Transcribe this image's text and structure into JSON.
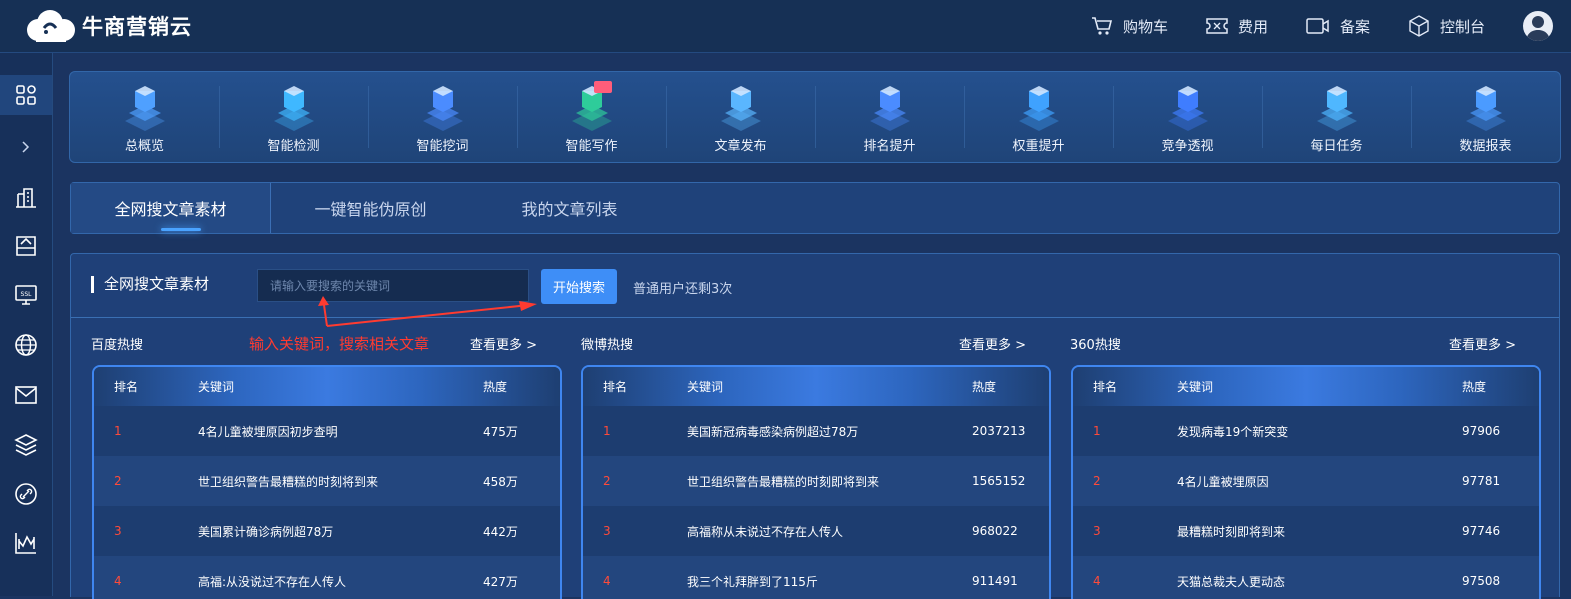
{
  "brand": {
    "name": "牛商营销云"
  },
  "topnav": [
    {
      "label": "购物车",
      "icon": "cart-icon"
    },
    {
      "label": "费用",
      "icon": "ticket-icon"
    },
    {
      "label": "备案",
      "icon": "camera-icon"
    },
    {
      "label": "控制台",
      "icon": "cube-icon"
    }
  ],
  "sidebar": [
    "grid-icon",
    "chevron-right-icon",
    "building-icon",
    "drive-icon",
    "ssl-icon",
    "globe-icon",
    "mail-icon",
    "layers-icon",
    "link-icon",
    "chart-icon"
  ],
  "modules": [
    {
      "label": "总概览",
      "color": "#4fa0ff"
    },
    {
      "label": "智能检测",
      "color": "#3fb8ff"
    },
    {
      "label": "智能挖词",
      "color": "#4b8cff"
    },
    {
      "label": "智能写作",
      "color": "#2ecc9a"
    },
    {
      "label": "文章发布",
      "color": "#5ab6ff"
    },
    {
      "label": "排名提升",
      "color": "#4b8cff"
    },
    {
      "label": "权重提升",
      "color": "#3fa2ff"
    },
    {
      "label": "竞争透视",
      "color": "#3f7dff"
    },
    {
      "label": "每日任务",
      "color": "#4fb7ff"
    },
    {
      "label": "数据报表",
      "color": "#4b9bff"
    }
  ],
  "tabs": [
    {
      "label": "全网搜文章素材",
      "active": true
    },
    {
      "label": "一键智能伪原创",
      "active": false
    },
    {
      "label": "我的文章列表",
      "active": false
    }
  ],
  "search": {
    "title": "全网搜文章素材",
    "placeholder": "请输入要搜索的关键词",
    "button": "开始搜索",
    "quota": "普通用户还剩3次",
    "annotation": "输入关键词，搜索相关文章"
  },
  "hot_lists": [
    {
      "title": "百度热搜",
      "more": "查看更多 >",
      "headers": {
        "rank": "排名",
        "keyword": "关键词",
        "heat": "热度"
      },
      "rows": [
        {
          "rank": "1",
          "keyword": "4名儿童被埋原因初步查明",
          "heat": "475万"
        },
        {
          "rank": "2",
          "keyword": "世卫组织警告最糟糕的时刻将到来",
          "heat": "458万"
        },
        {
          "rank": "3",
          "keyword": "美国累计确诊病例超78万",
          "heat": "442万"
        },
        {
          "rank": "4",
          "keyword": "高福:从没说过不存在人传人",
          "heat": "427万"
        }
      ]
    },
    {
      "title": "微博热搜",
      "more": "查看更多 >",
      "headers": {
        "rank": "排名",
        "keyword": "关键词",
        "heat": "热度"
      },
      "rows": [
        {
          "rank": "1",
          "keyword": "美国新冠病毒感染病例超过78万",
          "heat": "2037213"
        },
        {
          "rank": "2",
          "keyword": "世卫组织警告最糟糕的时刻即将到来",
          "heat": "1565152"
        },
        {
          "rank": "3",
          "keyword": "高福称从未说过不存在人传人",
          "heat": "968022"
        },
        {
          "rank": "4",
          "keyword": "我三个礼拜胖到了115斤",
          "heat": "911491"
        }
      ]
    },
    {
      "title": "360热搜",
      "more": "查看更多 >",
      "headers": {
        "rank": "排名",
        "keyword": "关键词",
        "heat": "热度"
      },
      "rows": [
        {
          "rank": "1",
          "keyword": "发现病毒19个新突变",
          "heat": "97906"
        },
        {
          "rank": "2",
          "keyword": "4名儿童被埋原因",
          "heat": "97781"
        },
        {
          "rank": "3",
          "keyword": "最糟糕时刻即将到来",
          "heat": "97746"
        },
        {
          "rank": "4",
          "keyword": "天猫总裁夫人更动态",
          "heat": "97508"
        }
      ]
    }
  ]
}
